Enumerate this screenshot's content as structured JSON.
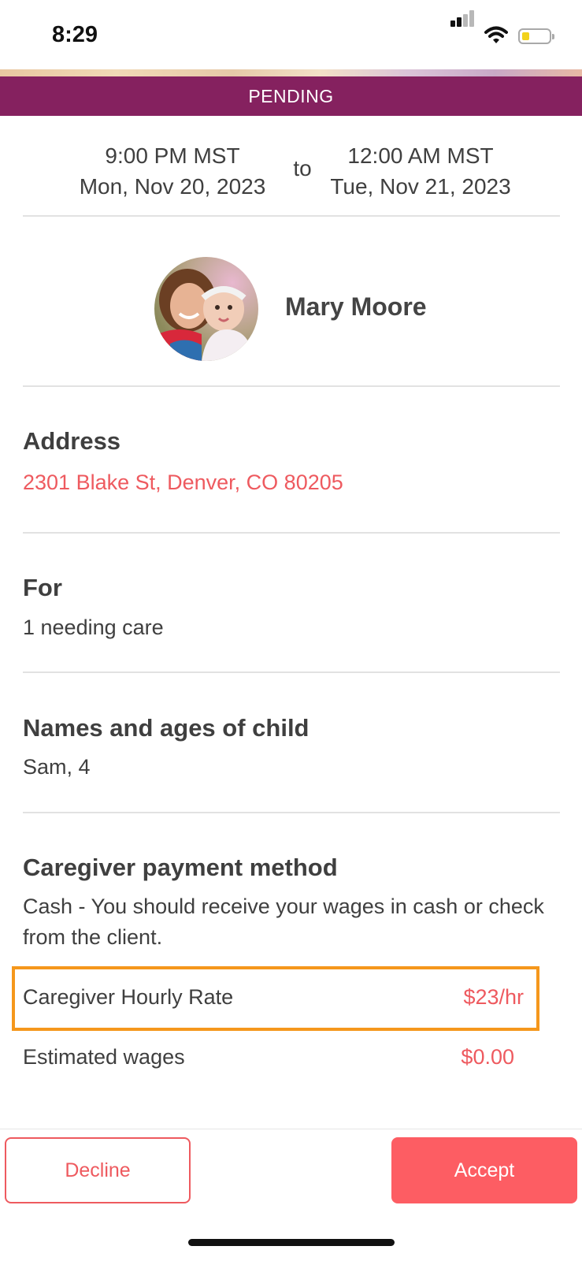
{
  "status_bar": {
    "time": "8:29"
  },
  "booking": {
    "status": "PENDING",
    "start_time": "9:00 PM MST",
    "start_date": "Mon, Nov 20, 2023",
    "separator": "to",
    "end_time": "12:00 AM MST",
    "end_date": "Tue, Nov 21, 2023"
  },
  "client": {
    "name": "Mary Moore"
  },
  "details": {
    "address_title": "Address",
    "address_value": "2301 Blake St, Denver, CO 80205",
    "for_title": "For",
    "for_value": "1 needing care",
    "children_title": "Names and ages of child",
    "children_value": "Sam, 4",
    "payment_title": "Caregiver payment method",
    "payment_value": "Cash - You should receive your wages in cash or check from the client.",
    "rate_label": "Caregiver Hourly Rate",
    "rate_value": "$23/hr",
    "wages_label": "Estimated wages",
    "wages_value": "$0.00"
  },
  "actions": {
    "decline_label": "Decline",
    "accept_label": "Accept"
  },
  "colors": {
    "banner": "#85215f",
    "accent": "#ee5a5f",
    "accept_button": "#fd5d63",
    "highlight_border": "#f5971c"
  }
}
